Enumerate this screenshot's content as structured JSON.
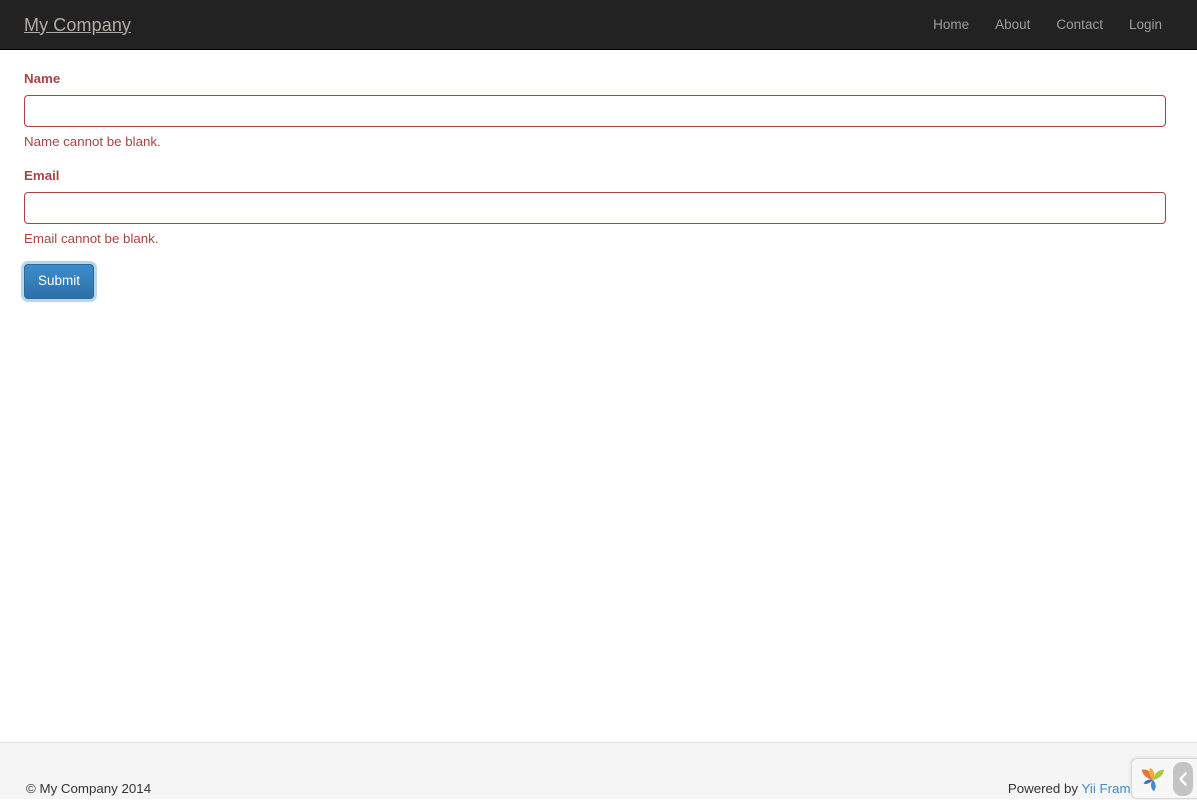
{
  "header": {
    "brand": "My Company",
    "nav": [
      {
        "label": "Home",
        "name": "nav-link-home"
      },
      {
        "label": "About",
        "name": "nav-link-about"
      },
      {
        "label": "Contact",
        "name": "nav-link-contact"
      },
      {
        "label": "Login",
        "name": "nav-link-login"
      }
    ]
  },
  "form": {
    "name_field": {
      "label": "Name",
      "value": "",
      "placeholder": "",
      "error": "Name cannot be blank."
    },
    "email_field": {
      "label": "Email",
      "value": "",
      "placeholder": "",
      "error": "Email cannot be blank."
    },
    "submit_label": "Submit"
  },
  "footer": {
    "copyright": "© My Company 2014",
    "powered_prefix": "Powered by ",
    "powered_link": "Yii Framework"
  },
  "debug_toolbar": {
    "logo_name": "yii-logo-icon",
    "toggle_name": "chevron-left-icon"
  },
  "colors": {
    "navbar_bg": "#222222",
    "brand_text": "#b5aca4",
    "nav_link": "#9d9d9d",
    "error_red": "#a94442",
    "button_blue": "#3276b1",
    "link_blue": "#428bca",
    "footer_bg": "#f5f5f5"
  }
}
